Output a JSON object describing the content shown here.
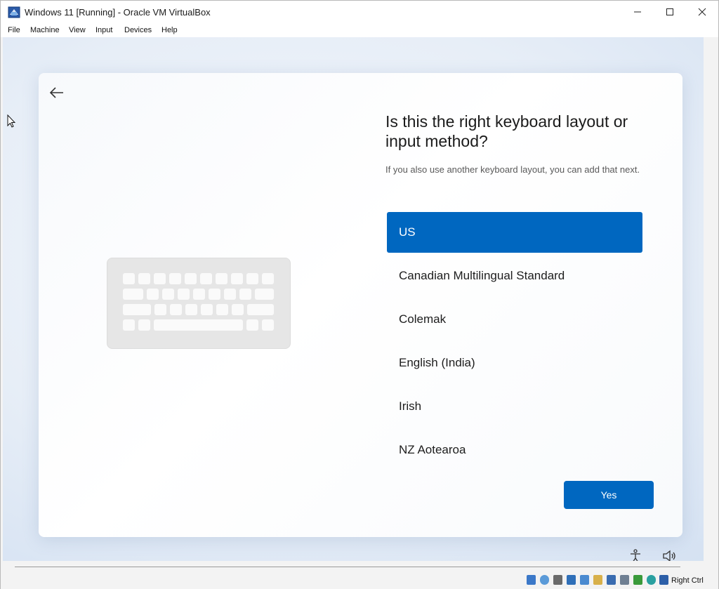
{
  "window": {
    "title": "Windows 11 [Running] - Oracle VM VirtualBox",
    "app_icon": "virtualbox-icon"
  },
  "menubar": {
    "items": [
      "File",
      "Machine",
      "View",
      "Input",
      "Devices",
      "Help"
    ]
  },
  "oobe": {
    "heading": "Is this the right keyboard layout or input method?",
    "subtext": "If you also use another keyboard layout, you can add that next.",
    "layouts": [
      {
        "label": "US",
        "selected": true
      },
      {
        "label": "Canadian Multilingual Standard",
        "selected": false
      },
      {
        "label": "Colemak",
        "selected": false
      },
      {
        "label": "English (India)",
        "selected": false
      },
      {
        "label": "Irish",
        "selected": false
      },
      {
        "label": "NZ Aotearoa",
        "selected": false
      }
    ],
    "yes_label": "Yes",
    "accent_color": "#0067c0"
  },
  "statusbar": {
    "host_key": "Right Ctrl",
    "icons": [
      "hard-disk-icon",
      "optical-drive-icon",
      "audio-icon",
      "network-icon",
      "usb-icon",
      "shared-folder-icon",
      "display-icon",
      "recording-icon",
      "cpu-icon",
      "mouse-integration-icon",
      "keyboard-capture-icon"
    ]
  }
}
